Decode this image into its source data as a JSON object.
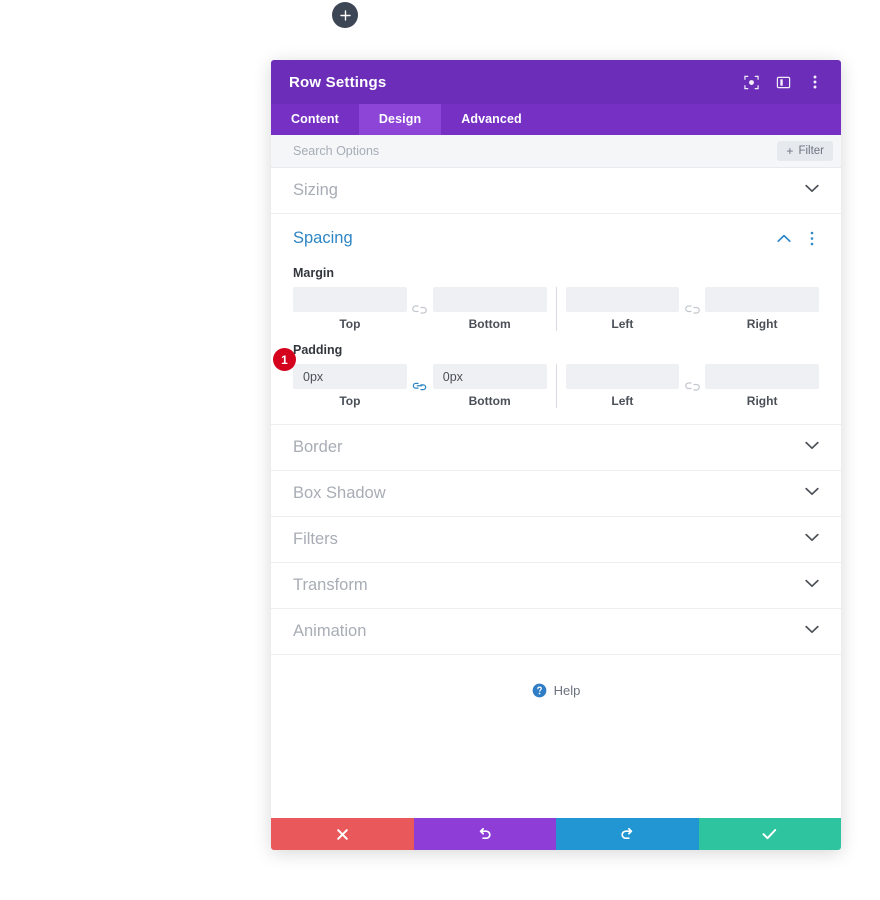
{
  "canvas": {
    "add_button": {
      "icon": "plus-icon",
      "label": "+"
    }
  },
  "modal": {
    "title": "Row Settings",
    "header_icons": [
      {
        "name": "fullscreen-focus-icon"
      },
      {
        "name": "panel-layout-icon"
      },
      {
        "name": "more-options-icon"
      }
    ],
    "tabs": [
      {
        "label": "Content",
        "active": false
      },
      {
        "label": "Design",
        "active": true
      },
      {
        "label": "Advanced",
        "active": false
      }
    ],
    "search": {
      "placeholder": "Search Options",
      "value": ""
    },
    "filter_button": {
      "plus": "+",
      "label": "Filter"
    },
    "sections": [
      {
        "label": "Sizing",
        "state": "collapsed"
      },
      {
        "label": "Spacing",
        "state": "expanded"
      },
      {
        "label": "Border",
        "state": "collapsed"
      },
      {
        "label": "Box Shadow",
        "state": "collapsed"
      },
      {
        "label": "Filters",
        "state": "collapsed"
      },
      {
        "label": "Transform",
        "state": "collapsed"
      },
      {
        "label": "Animation",
        "state": "collapsed"
      }
    ],
    "spacing": {
      "badge": "1",
      "margin": {
        "label": "Margin",
        "top": {
          "value": "",
          "label": "Top"
        },
        "bottom": {
          "value": "",
          "label": "Bottom"
        },
        "left": {
          "value": "",
          "label": "Left"
        },
        "right": {
          "value": "",
          "label": "Right"
        },
        "link_tb": "unlinked",
        "link_lr": "unlinked"
      },
      "padding": {
        "label": "Padding",
        "top": {
          "value": "0px",
          "label": "Top"
        },
        "bottom": {
          "value": "0px",
          "label": "Bottom"
        },
        "left": {
          "value": "",
          "label": "Left"
        },
        "right": {
          "value": "",
          "label": "Right"
        },
        "link_tb": "linked",
        "link_lr": "unlinked"
      }
    },
    "help": {
      "label": "Help",
      "icon": "question-circle-icon"
    },
    "footer": [
      {
        "name": "cancel-button",
        "icon": "close-icon"
      },
      {
        "name": "undo-button",
        "icon": "undo-icon"
      },
      {
        "name": "redo-button",
        "icon": "redo-icon"
      },
      {
        "name": "save-button",
        "icon": "check-icon"
      }
    ]
  },
  "colors": {
    "header_purple": "#6c2eb9",
    "tabbar_purple": "#7631c4",
    "tab_active_purple": "#8c45d6",
    "accent_blue": "#2e86c5",
    "badge_red": "#d4021c",
    "cancel_red": "#e9595b",
    "undo_purple": "#8e3ed6",
    "redo_blue": "#2196d3",
    "save_green": "#2ec4a0"
  }
}
